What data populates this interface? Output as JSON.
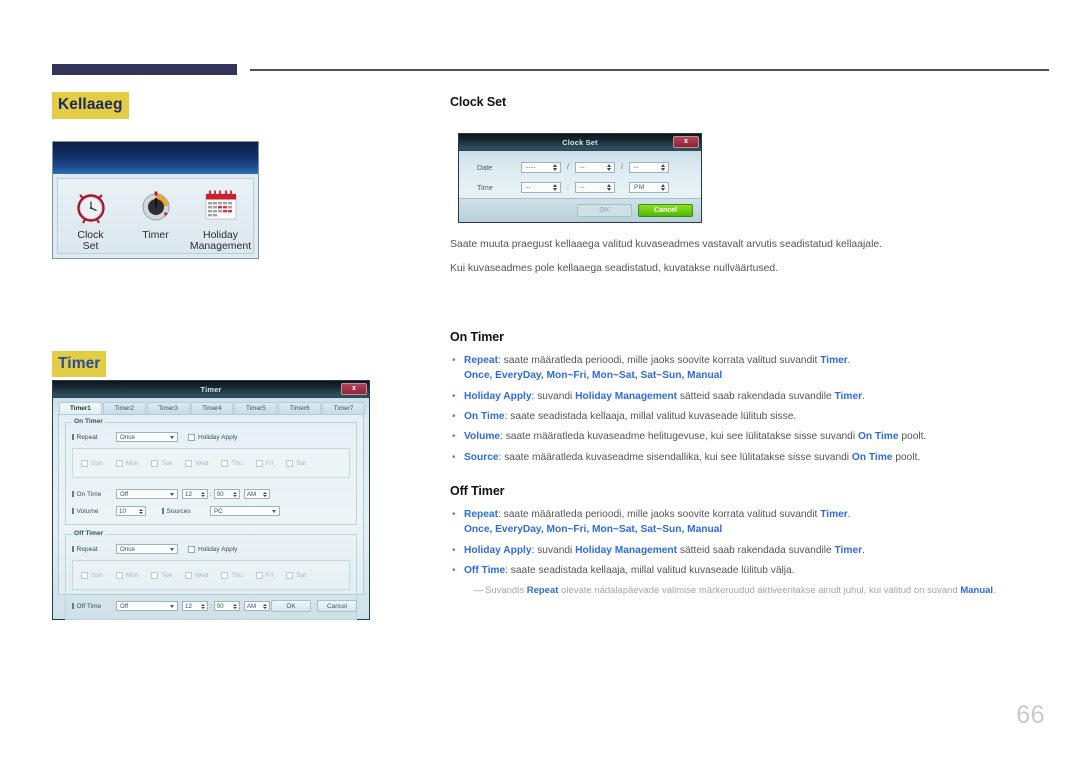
{
  "page": {
    "number": "66"
  },
  "left": {
    "section1_tag": "Kellaaeg",
    "section2_tag": "Timer",
    "icon_panel": {
      "items": [
        {
          "icon": "alarm-clock-icon",
          "caption": "Clock\nSet"
        },
        {
          "icon": "timer-dial-icon",
          "caption": "Timer"
        },
        {
          "icon": "calendar-icon",
          "caption": "Holiday\nManagement"
        }
      ]
    }
  },
  "clockset_dialog": {
    "title": "Clock Set",
    "close_label": "x",
    "rows": [
      {
        "label": "Date",
        "fields": [
          {
            "value": "----"
          },
          {
            "sep": "/"
          },
          {
            "value": "--"
          },
          {
            "sep": "/"
          },
          {
            "value": "--"
          }
        ]
      },
      {
        "label": "Time",
        "fields": [
          {
            "value": "--"
          },
          {
            "sep": ":"
          },
          {
            "value": "--"
          },
          {
            "sep": ""
          },
          {
            "value": "PM"
          }
        ]
      }
    ],
    "ok_label": "OK",
    "cancel_label": "Cancel"
  },
  "timer_dialog": {
    "title": "Timer",
    "close_label": "x",
    "tabs": [
      {
        "label": "Timer1",
        "active": true
      },
      {
        "label": "Timer2",
        "active": false
      },
      {
        "label": "Timer3",
        "active": false
      },
      {
        "label": "Timer4",
        "active": false
      },
      {
        "label": "Timer5",
        "active": false
      },
      {
        "label": "Timer6",
        "active": false
      },
      {
        "label": "Timer7",
        "active": false
      }
    ],
    "on_group": {
      "legend": "On Timer",
      "repeat_label": "Repeat",
      "repeat_value": "Once",
      "holiday_apply_label": "Holiday Apply",
      "days": [
        "Sun",
        "Mon",
        "Tue",
        "Wed",
        "Thu",
        "Fri",
        "Sat"
      ],
      "time_label": "On Time",
      "time_value": "Off",
      "hour": "12",
      "minute": "00",
      "meridiem": "AM",
      "volume_label": "Volume",
      "volume_value": "10",
      "source_label": "Sources",
      "source_value": "PC"
    },
    "off_group": {
      "legend": "Off Timer",
      "repeat_label": "Repeat",
      "repeat_value": "Once",
      "holiday_apply_label": "Holiday Apply",
      "days": [
        "Sun",
        "Mon",
        "Tue",
        "Wed",
        "Thu",
        "Fri",
        "Sat"
      ],
      "time_label": "Off Time",
      "time_value": "Off",
      "hour": "12",
      "minute": "00",
      "meridiem": "AM"
    },
    "ok_label": "OK",
    "cancel_label": "Cancel"
  },
  "right": {
    "clock_set": {
      "heading": "Clock Set",
      "para1": "Saate muuta praegust kellaaega valitud kuvaseadmes vastavalt arvutis seadistatud kellaajale.",
      "para2": "Kui kuvaseadmes pole kellaaega seadistatud, kuvatakse nullväärtused."
    },
    "on_timer": {
      "heading": "On Timer",
      "bullets": [
        {
          "key": "Repeat",
          "rest": ": saate määratleda perioodi, mille jaoks soovite korrata valitud suvandit ",
          "key2": "Timer",
          "tail": ".",
          "options": "Once, EveryDay, Mon~Fri, Mon~Sat, Sat~Sun, Manual"
        },
        {
          "key": "Holiday Apply",
          "rest": ": suvandi ",
          "key2": "Holiday Management",
          "rest2": " sätteid saab rakendada suvandile ",
          "key3": "Timer",
          "tail": "."
        },
        {
          "key": "On Time",
          "rest": ": saate seadistada kellaaja, millal valitud kuvaseade lülitub sisse."
        },
        {
          "key": "Volume",
          "rest": ": saate määratleda kuvaseadme helitugevuse, kui see lülitatakse sisse suvandi ",
          "key2": "On Time",
          "tail": " poolt."
        },
        {
          "key": "Source",
          "rest": ": saate määratleda kuvaseadme sisendallika, kui see lülitatakse sisse suvandi ",
          "key2": "On Time",
          "tail": " poolt."
        }
      ]
    },
    "off_timer": {
      "heading": "Off Timer",
      "bullets": [
        {
          "key": "Repeat",
          "rest": ": saate määratleda perioodi, mille jaoks soovite korrata valitud suvandit ",
          "key2": "Timer",
          "tail": ".",
          "options": "Once, EveryDay, Mon~Fri, Mon~Sat, Sat~Sun, Manual"
        },
        {
          "key": "Holiday Apply",
          "rest": ": suvandi ",
          "key2": "Holiday Management",
          "rest2": " sätteid saab rakendada suvandile ",
          "key3": "Timer",
          "tail": "."
        },
        {
          "key": "Off Time",
          "rest": ": saate seadistada kellaaja, millal valitud kuvaseade lülitub välja."
        }
      ],
      "note": {
        "pre": "Suvandis ",
        "k1": "Repeat",
        "mid": " olevate nädalapäevade valimise märkeruudud aktiveeritakse ainult juhul, kui valitud on suvand ",
        "k2": "Manual",
        "post": "."
      }
    }
  }
}
